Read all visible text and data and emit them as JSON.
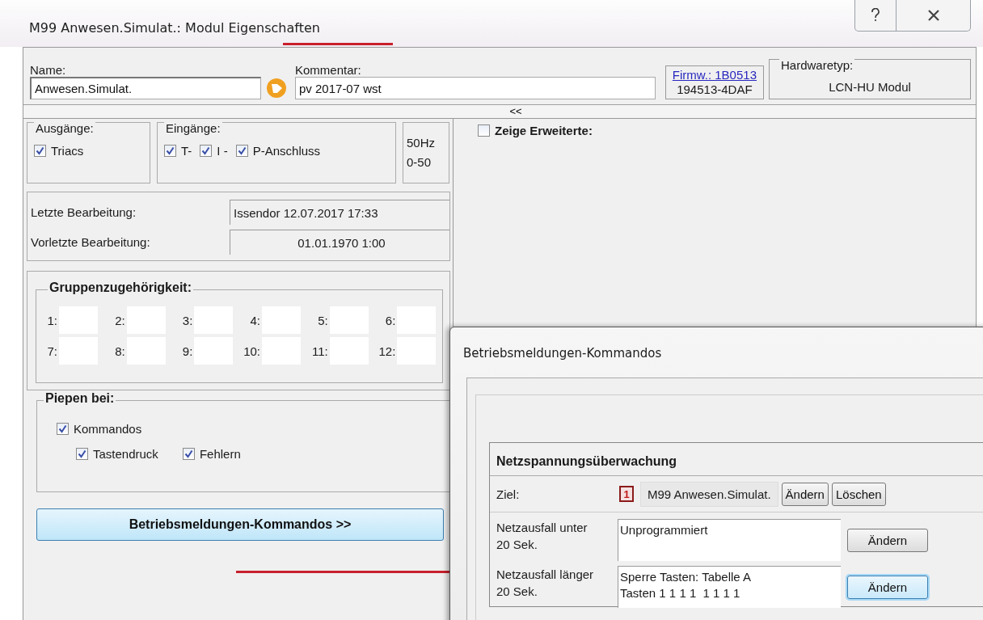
{
  "window": {
    "title": "M99 Anwesen.Simulat.: Modul Eigenschaften"
  },
  "header": {
    "name_label": "Name:",
    "name_value": "Anwesen.Simulat.",
    "comment_label": "Kommentar:",
    "comment_value": "pv 2017-07 wst",
    "firmware_link": "Firmw.: 1B0513",
    "firmware_id": "194513-4DAF",
    "hardware_label": "Hardwaretyp:",
    "hardware_value": "LCN-HU Modul",
    "collapse": "<<"
  },
  "outputs": {
    "title": "Ausgänge:",
    "items": [
      {
        "label": "Triacs",
        "checked": true
      }
    ]
  },
  "inputs": {
    "title": "Eingänge:",
    "items": [
      {
        "label": "T-",
        "checked": true
      },
      {
        "label": "I -",
        "checked": true
      },
      {
        "label": "P-Anschluss",
        "checked": true
      }
    ]
  },
  "frequency": [
    "50Hz",
    "0-50"
  ],
  "edits": [
    {
      "label": "Letzte Bearbeitung:",
      "value": "Issendor 12.07.2017 17:33",
      "centered": false
    },
    {
      "label": "Vorletzte Bearbeitung:",
      "value": "01.01.1970 1:00",
      "centered": true
    }
  ],
  "groups": {
    "title": "Gruppenzugehörigkeit:",
    "items": [
      "1:",
      "2:",
      "3:",
      "4:",
      "5:",
      "6:",
      "7:",
      "8:",
      "9:",
      "10:",
      "11:",
      "12:"
    ]
  },
  "beep": {
    "title": "Piepen bei:",
    "items": [
      {
        "label": "Kommandos",
        "checked": true,
        "children": [
          {
            "label": "Tastendruck",
            "checked": true
          },
          {
            "label": "Fehlern",
            "checked": true
          }
        ]
      }
    ]
  },
  "commands_button": "Betriebsmeldungen-Kommandos >>",
  "show_extended": {
    "label": "Zeige Erweiterte:",
    "checked": false
  },
  "dialog": {
    "title": "Betriebsmeldungen-Kommandos",
    "section_title": "Netzspannungsüberwachung",
    "target": {
      "label": "Ziel:",
      "badge": "1",
      "value": "M99 Anwesen.Simulat.",
      "buttons": [
        "Ändern",
        "Löschen"
      ]
    },
    "rows": [
      {
        "label": "Netzausfall unter 20 Sek.",
        "value": [
          "Unprogrammiert"
        ],
        "button": "Ändern",
        "focused": false
      },
      {
        "label": "Netzausfall länger 20 Sek.",
        "value": [
          "Sperre Tasten: Tabelle A",
          "Tasten 1 1 1 1  1 1 1 1"
        ],
        "button": "Ändern",
        "focused": true
      }
    ]
  }
}
